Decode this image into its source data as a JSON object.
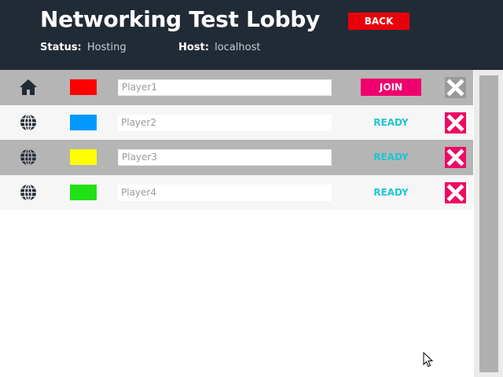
{
  "header": {
    "title": "Networking Test Lobby",
    "back_label": "BACK",
    "status_label": "Status:",
    "status_value": "Hosting",
    "host_label": "Host:",
    "host_value": "localhost"
  },
  "players": [
    {
      "icon": "home-icon",
      "color": "#ff0000",
      "name": "Player1",
      "action": "JOIN",
      "action_type": "join"
    },
    {
      "icon": "globe-icon",
      "color": "#0099ff",
      "name": "Player2",
      "action": "READY",
      "action_type": "ready"
    },
    {
      "icon": "globe-icon",
      "color": "#ffff00",
      "name": "Player3",
      "action": "READY",
      "action_type": "ready"
    },
    {
      "icon": "globe-icon",
      "color": "#22e016",
      "name": "Player4",
      "action": "READY",
      "action_type": "ready"
    }
  ],
  "colors": {
    "header_bg": "#212b36",
    "back_button": "#e8000b",
    "join_button": "#f0006e",
    "ready_text": "#1fc6d2",
    "remove_bg_active": "#ee0a63",
    "remove_bg_local": "#9a9a9a"
  }
}
